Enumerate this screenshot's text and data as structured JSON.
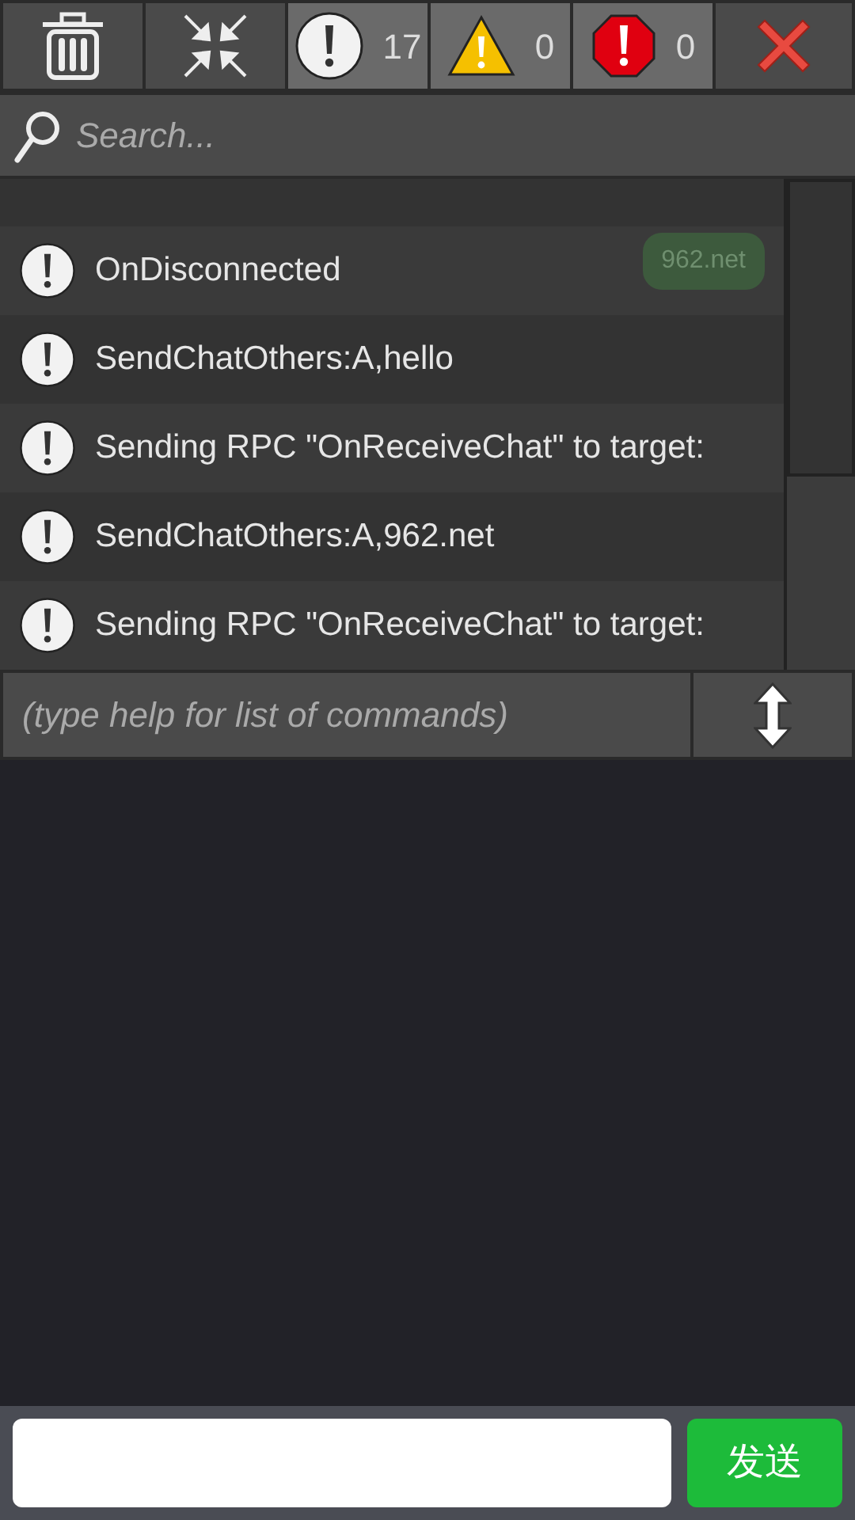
{
  "toolbar": {
    "filters": [
      {
        "kind": "info",
        "count": "17",
        "on": true
      },
      {
        "kind": "warning",
        "count": "0",
        "on": true
      },
      {
        "kind": "error",
        "count": "0",
        "on": true
      }
    ]
  },
  "search": {
    "placeholder": "Search..."
  },
  "log": [
    {
      "kind": "info",
      "text": "OnDisconnected",
      "bubble": "962.net"
    },
    {
      "kind": "info",
      "text": "SendChatOthers:A,hello"
    },
    {
      "kind": "info",
      "text": "Sending RPC \"OnReceiveChat\" to target:"
    },
    {
      "kind": "info",
      "text": "SendChatOthers:A,962.net"
    },
    {
      "kind": "info",
      "text": "Sending RPC \"OnReceiveChat\" to target:"
    }
  ],
  "command": {
    "placeholder": "(type help for list of commands)"
  },
  "chat": {
    "send_label": "发送"
  }
}
